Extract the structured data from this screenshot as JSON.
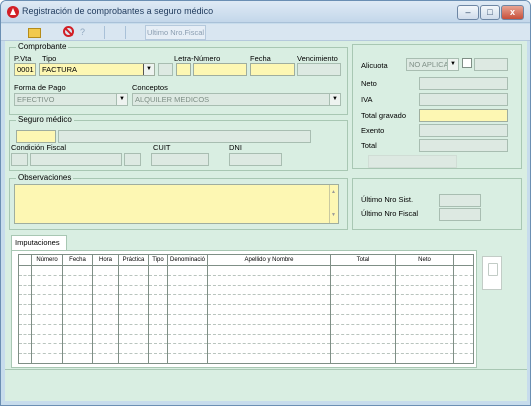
{
  "window": {
    "title": "Registración de comprobantes a seguro médico",
    "min": "–",
    "max": "□",
    "close": "x"
  },
  "toolbar": {
    "help_label": "?",
    "ultimo_btn": "Ultimo Nro.Fiscal"
  },
  "comprobante": {
    "legend": "Comprobante",
    "pvta_label": "P.Vta",
    "tipo_label": "Tipo",
    "letra_label": "Letra-Número",
    "fecha_label": "Fecha",
    "venc_label": "Vencimiento",
    "pvta_value": "0001",
    "tipo_value": "FACTURA",
    "forma_label": "Forma de Pago",
    "forma_value": "EFECTIVO",
    "conceptos_label": "Conceptos",
    "conceptos_value": "ALQUILER MEDICOS"
  },
  "seguro": {
    "legend": "Seguro médico",
    "condicion_label": "Condición Fiscal",
    "cuit_label": "CUIT",
    "dni_label": "DNI"
  },
  "observaciones": {
    "legend": "Observaciones"
  },
  "totales": {
    "alicuota_label": "Alicuota",
    "alicuota_value": "NO APLICA",
    "neto_label": "Neto",
    "iva_label": "IVA",
    "total_gravado_label": "Total gravado",
    "exento_label": "Exento",
    "total_label": "Total"
  },
  "nros": {
    "sist_label": "Último Nro Sist.",
    "fiscal_label": "Último Nro Fiscal"
  },
  "imputaciones": {
    "tab": "Imputaciones",
    "columns": [
      "Número",
      "Fecha",
      "Hora",
      "Práctica",
      "Tipo",
      "Denominació",
      "Apellido y Nombre",
      "Total",
      "Neto"
    ]
  }
}
